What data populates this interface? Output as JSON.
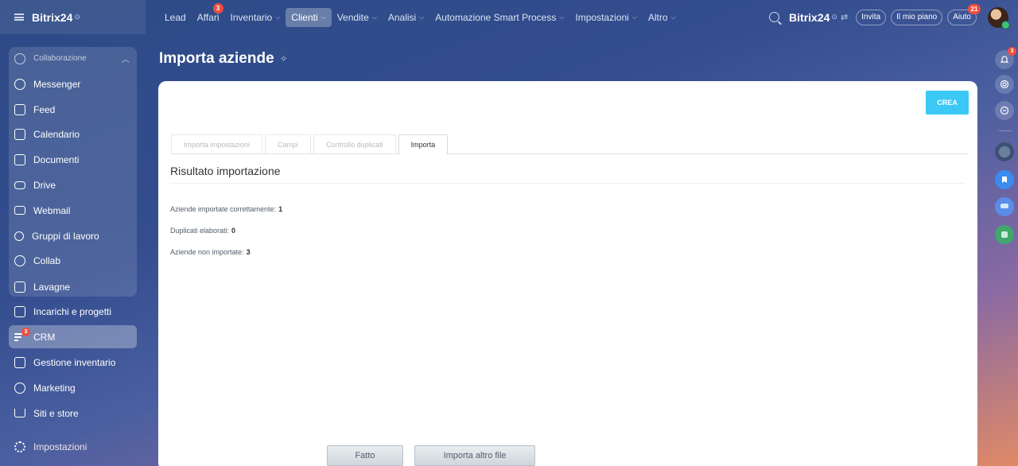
{
  "topbar": {
    "brand": "Bitrix24",
    "brand_sup": "⊙",
    "nav": [
      {
        "label": "Lead",
        "chevron": false
      },
      {
        "label": "Affari",
        "chevron": false,
        "badge": "3"
      },
      {
        "label": "Inventario",
        "chevron": true
      },
      {
        "label": "Clienti",
        "chevron": true,
        "active": true
      },
      {
        "label": "Vendite",
        "chevron": true
      },
      {
        "label": "Analisi",
        "chevron": true
      },
      {
        "label": "Automazione Smart Process",
        "chevron": true
      },
      {
        "label": "Impostazioni",
        "chevron": true
      },
      {
        "label": "Altro",
        "chevron": true
      }
    ],
    "brand2": "Bitrix24",
    "brand2_sup": "⊙",
    "invite_label": "Invita",
    "plan_label": "Il mio piano",
    "help_label": "Aiuto",
    "help_badge": "21"
  },
  "sidebar": {
    "group_label": "Collaborazione",
    "items": [
      {
        "label": "Messenger",
        "icon": "messenger-icon"
      },
      {
        "label": "Feed",
        "icon": "feed-icon"
      },
      {
        "label": "Calendario",
        "icon": "calendar-icon"
      },
      {
        "label": "Documenti",
        "icon": "documents-icon"
      },
      {
        "label": "Drive",
        "icon": "drive-icon"
      },
      {
        "label": "Webmail",
        "icon": "mail-icon"
      },
      {
        "label": "Gruppi di lavoro",
        "icon": "groups-icon"
      },
      {
        "label": "Collab",
        "icon": "collab-icon"
      },
      {
        "label": "Lavagne",
        "icon": "boards-icon"
      },
      {
        "label": "Incarichi e progetti",
        "icon": "tasks-icon"
      },
      {
        "label": "CRM",
        "icon": "crm-icon",
        "badge": "3"
      },
      {
        "label": "Gestione inventario",
        "icon": "inventory-icon"
      },
      {
        "label": "Marketing",
        "icon": "marketing-icon"
      },
      {
        "label": "Siti e store",
        "icon": "cart-icon"
      },
      {
        "label": "Impostazioni",
        "icon": "settings-icon"
      }
    ]
  },
  "page": {
    "title": "Importa aziende",
    "create_label": "CREA",
    "tabs": [
      "Importa impostazioni",
      "Campi",
      "Controllo duplicati",
      "Importa"
    ],
    "section_title": "Risultato importazione",
    "stats": [
      {
        "label": "Aziende importate correttamente:",
        "value": "1"
      },
      {
        "label": "Duplicati elaborati:",
        "value": "0"
      },
      {
        "label": "Aziende non importate:",
        "value": "3"
      }
    ],
    "done_label": "Fatto",
    "import_other_label": "Importa altro file"
  },
  "rail": {
    "notifications_badge": "3"
  },
  "colors": {
    "accent": "#3bc8f5",
    "badge": "#ef4f3d"
  }
}
